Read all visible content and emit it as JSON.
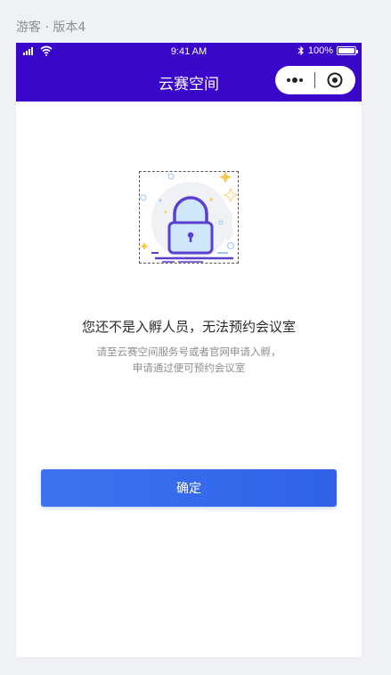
{
  "page_label": "游客 · 版本4",
  "status_bar": {
    "time": "9:41 AM",
    "battery": "100%"
  },
  "nav": {
    "title": "云赛空间"
  },
  "main": {
    "headline": "您还不是入孵人员，无法预约会议室",
    "desc_line1": "请至云赛空间服务号或者官网申请入孵，",
    "desc_line2": "申请通过便可预约会议室",
    "confirm_label": "确定"
  },
  "colors": {
    "nav_bg": "#3a06c9",
    "button": "#3067eb"
  }
}
